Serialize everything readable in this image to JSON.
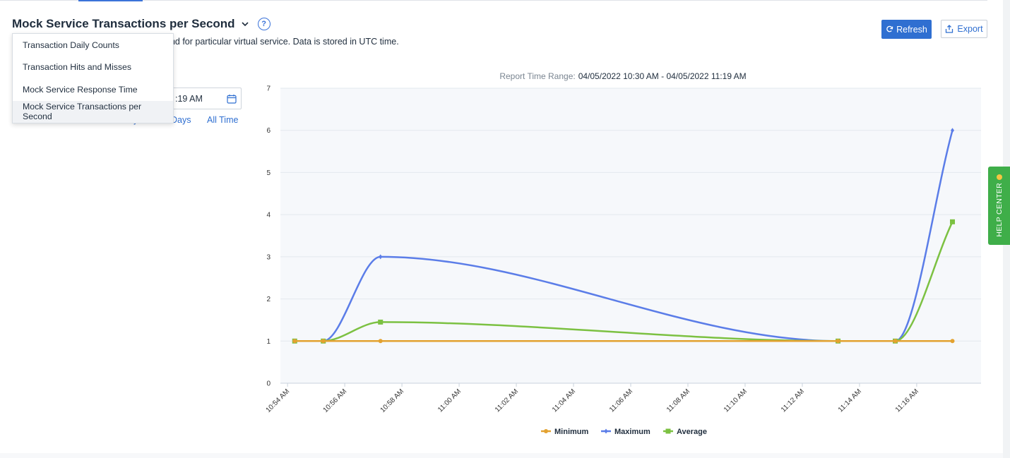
{
  "header": {
    "title": "Mock Service Transactions per Second",
    "help_glyph": "?",
    "description": "ond for particular virtual service. Data is stored in UTC time.",
    "refresh_label": "Refresh",
    "export_label": "Export"
  },
  "report_menu": {
    "items": [
      "Transaction Daily Counts",
      "Transaction Hits and Misses",
      "Mock Service Response Time",
      "Mock Service Transactions per Second"
    ],
    "selected_index": 3
  },
  "filters": {
    "date_value": ":19 AM",
    "quick_days": "Days",
    "quick_all_time": "All Time",
    "quick_partial": "y"
  },
  "help_center": {
    "label": "HELP CENTER"
  },
  "colors": {
    "minimum": "#e3a230",
    "maximum": "#5b7de8",
    "average": "#7cc142",
    "primary": "#2f6fd1",
    "help": "#3fae49"
  },
  "chart_data": {
    "type": "line",
    "range_label": "Report Time Range:",
    "range_value": "04/05/2022 10:30 AM - 04/05/2022 11:19 AM",
    "x_ticks": [
      "10:54 AM",
      "10:56 AM",
      "10:58 AM",
      "11:00 AM",
      "11:02 AM",
      "11:04 AM",
      "11:06 AM",
      "11:08 AM",
      "11:10 AM",
      "11:12 AM",
      "11:14 AM",
      "11:16 AM"
    ],
    "x_tick_minutes": [
      54,
      56,
      58,
      60,
      62,
      64,
      66,
      68,
      70,
      72,
      74,
      76
    ],
    "xlim": [
      53.75,
      78.25
    ],
    "ylim": [
      0,
      7
    ],
    "y_ticks": [
      0,
      1,
      2,
      3,
      4,
      5,
      6,
      7
    ],
    "grid": true,
    "legend": "bottom-center",
    "x_minutes": [
      54.25,
      55.25,
      57.25,
      73.25,
      75.25,
      77.25
    ],
    "series": [
      {
        "name": "Minimum",
        "values": [
          1,
          1,
          1,
          1,
          1,
          1
        ]
      },
      {
        "name": "Maximum",
        "values": [
          1,
          1,
          3,
          1,
          1,
          6
        ]
      },
      {
        "name": "Average",
        "values": [
          1,
          1,
          1.45,
          1,
          1,
          3.83
        ]
      }
    ]
  }
}
